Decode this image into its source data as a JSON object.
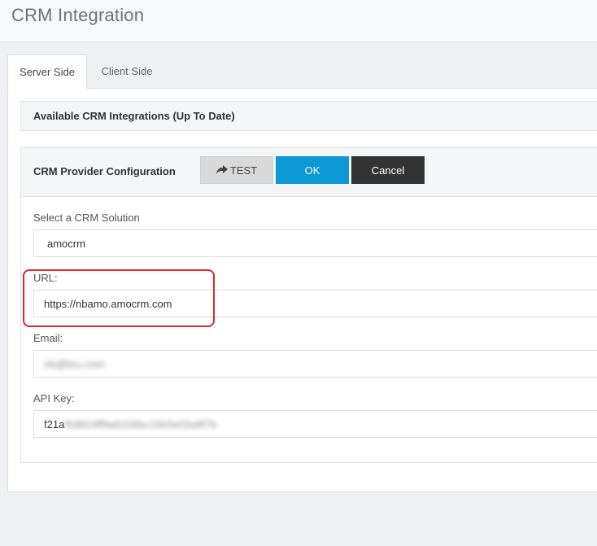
{
  "header": {
    "title": "CRM Integration"
  },
  "tabs": [
    {
      "label": "Server Side",
      "active": true
    },
    {
      "label": "Client Side",
      "active": false
    }
  ],
  "available_panel": {
    "title": "Available CRM Integrations (Up To Date)"
  },
  "config_panel": {
    "title": "CRM Provider Configuration",
    "buttons": {
      "test": "TEST",
      "ok": "OK",
      "cancel": "Cancel"
    },
    "fields": {
      "crm_solution": {
        "label": "Select a CRM Solution",
        "value": "amocrm"
      },
      "url": {
        "label": "URL:",
        "value": "https://nbamo.amocrm.com"
      },
      "email": {
        "label": "Email:",
        "value": "nb@bru.com"
      },
      "api_key": {
        "label": "API Key:",
        "value_visible": "f21a",
        "value_obscured": "f0d924ff9a6100bc15b5e02a9f7b"
      }
    }
  },
  "colors": {
    "ok_button": "#0c97d5",
    "cancel_button": "#333333",
    "test_button": "#d9d9d9",
    "highlight": "#e0262b"
  }
}
